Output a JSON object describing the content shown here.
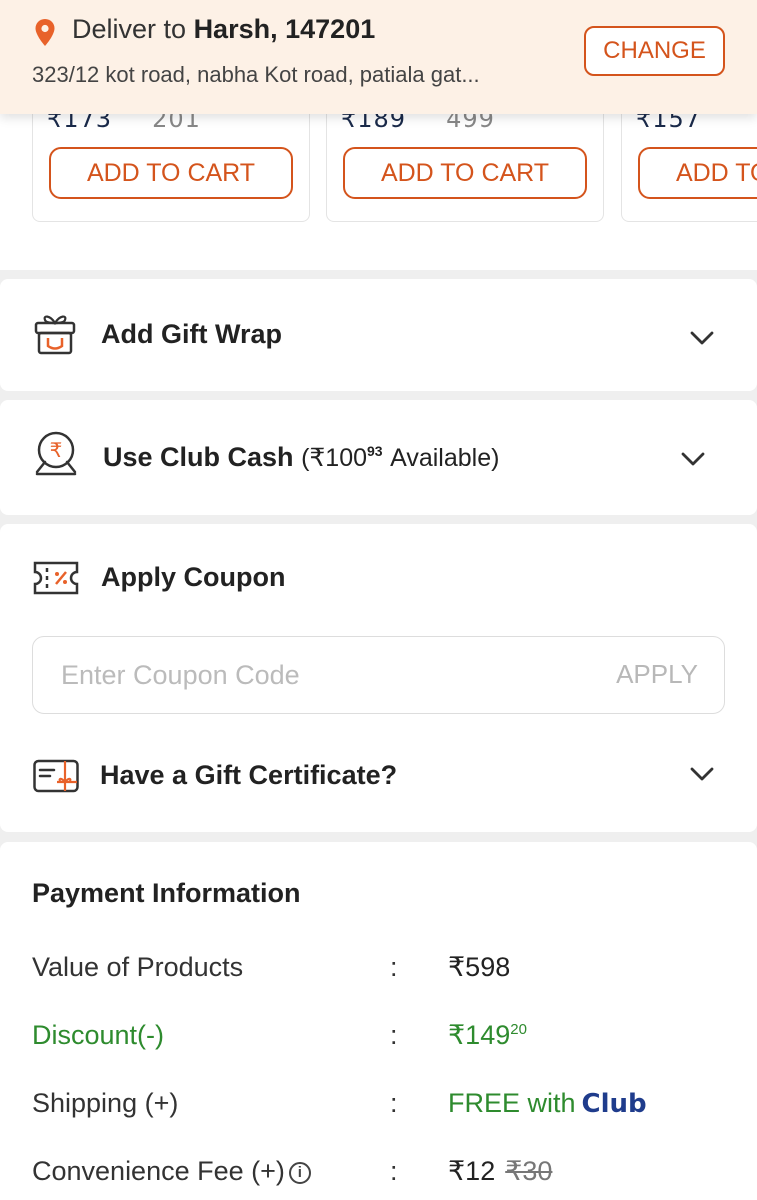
{
  "header": {
    "deliver_prefix": "Deliver to",
    "deliver_name": "Harsh,",
    "pincode": "147201",
    "address": "323/12 kot road, nabha Kot road, patiala gat...",
    "change_label": "CHANGE"
  },
  "products": {
    "cards": [
      {
        "price": "₹173",
        "mrp": "201",
        "add_label": "ADD TO CART"
      },
      {
        "price": "₹189",
        "mrp": "499",
        "add_label": "ADD TO CART"
      },
      {
        "price": "₹157",
        "mrp": "",
        "add_label": "ADD TO CART"
      }
    ]
  },
  "gift_wrap": {
    "label": "Add Gift Wrap"
  },
  "club_cash": {
    "label": "Use Club Cash",
    "open_paren": "(₹",
    "amount": "100",
    "amount_decimal": "93",
    "available": "Available)"
  },
  "coupon": {
    "title": "Apply Coupon",
    "placeholder": "Enter Coupon Code",
    "apply_label": "APPLY"
  },
  "gift_certificate": {
    "label": "Have a Gift Certificate?"
  },
  "payment": {
    "title": "Payment Information",
    "colon": ":",
    "rows": [
      {
        "label": "Value of Products",
        "value": "₹598"
      },
      {
        "label": "Discount(-)",
        "value": "₹149",
        "value_decimal": "20"
      },
      {
        "label": "Shipping (+)",
        "value": "FREE  with",
        "badge": "Club"
      },
      {
        "label": "Convenience Fee (+)",
        "value": "₹12",
        "strike": "₹30"
      }
    ]
  },
  "colors": {
    "accent": "#d4541c",
    "green": "#2e8b2e",
    "header_bg": "#fdf1e6",
    "club_blue": "#1f3c8c"
  }
}
